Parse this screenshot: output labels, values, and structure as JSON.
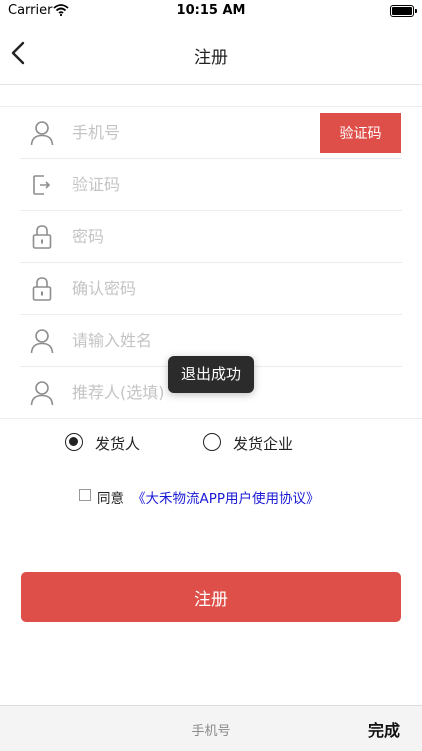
{
  "status_bar": {
    "carrier": "Carrier",
    "time": "10:15 AM"
  },
  "nav": {
    "title": "注册"
  },
  "form": {
    "phone": {
      "placeholder": "手机号",
      "code_button": "验证码"
    },
    "code": {
      "placeholder": "验证码"
    },
    "password": {
      "placeholder": "密码"
    },
    "confirm_password": {
      "placeholder": "确认密码"
    },
    "name": {
      "placeholder": "请输入姓名"
    },
    "referrer": {
      "placeholder": "推荐人(选填)"
    }
  },
  "toast": {
    "text": "退出成功"
  },
  "roles": {
    "shipper": {
      "label": "发货人",
      "selected": true
    },
    "enterprise": {
      "label": "发货企业",
      "selected": false
    }
  },
  "agreement": {
    "prefix": "同意",
    "link": "《大禾物流APP用户使用协议》",
    "checked": false
  },
  "submit": {
    "label": "注册"
  },
  "keyboard_bar": {
    "hint": "手机号",
    "done": "完成"
  },
  "colors": {
    "accent": "#de4f4a",
    "link": "#1a1ad6"
  }
}
